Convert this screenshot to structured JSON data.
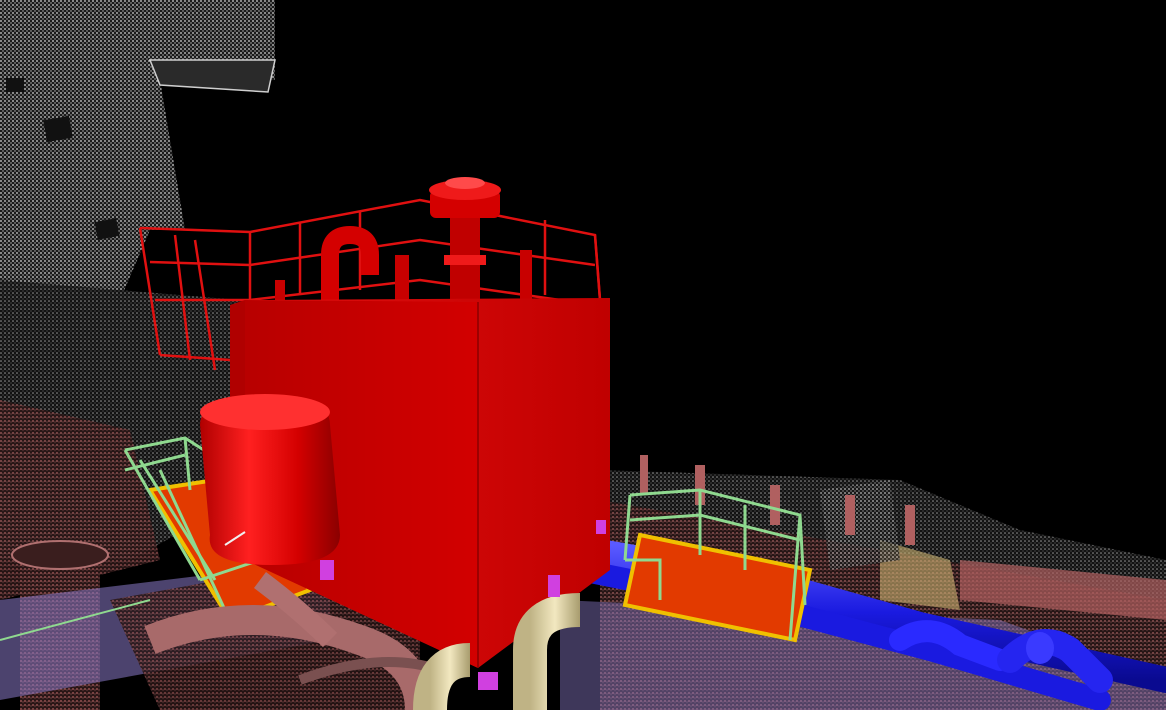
{
  "viewport": {
    "kind": "3d-point-cloud-with-cad-overlay",
    "background": "#000000"
  },
  "colors": {
    "tank": "#d40000",
    "tank_dark": "#9a0000",
    "tank_light": "#ef1a1a",
    "railing_red": "#e01010",
    "railing_green": "#8fd98f",
    "platform_orange": "#e23a00",
    "platform_trim": "#f0c000",
    "pipe_blue": "#1a1ae0",
    "pipe_blue_light": "#3a3aff",
    "support_magenta": "#d040e0",
    "deck_violet": "#8a7ac8",
    "elbow_cream": "#e6dbab",
    "scan_white": "#d8d8d8",
    "scan_rust": "#b06060"
  },
  "icons": [
    "no-icons-visible"
  ],
  "text": {}
}
